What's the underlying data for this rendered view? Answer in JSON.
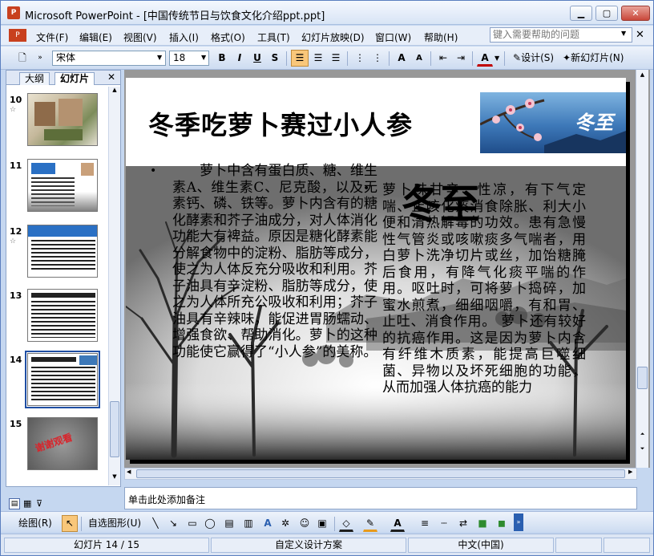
{
  "window": {
    "title": "Microsoft PowerPoint - [中国传统节日与饮食文化介绍ppt.ppt]"
  },
  "menu": [
    "文件(F)",
    "编辑(E)",
    "视图(V)",
    "插入(I)",
    "格式(O)",
    "工具(T)",
    "幻灯片放映(D)",
    "窗口(W)",
    "帮助(H)"
  ],
  "help": {
    "placeholder": "键入需要帮助的问题"
  },
  "toolbar": {
    "font": "宋体",
    "size": "18",
    "design": "设计(S)",
    "new_slide": "新幻灯片(N)"
  },
  "panel": {
    "tabs": [
      "大纲",
      "幻灯片"
    ]
  },
  "slides": [
    {
      "num": "10",
      "star": "☆"
    },
    {
      "num": "11"
    },
    {
      "num": "12",
      "star": "☆"
    },
    {
      "num": "13"
    },
    {
      "num": "14"
    },
    {
      "num": "15",
      "label": "谢谢观看"
    }
  ],
  "slide": {
    "title": "冬季吃萝卜赛过小人参",
    "bullet": "•",
    "col1": "　　萝卜中含有蛋白质、糖、维生素A、维生素C、尼克酸，以及无素钙、磷、铁等。萝卜内含有的糖化酵素和芥子油成分，对人体消化功能大有裨益。原因是糖化酵素能分解食物中的淀粉、脂肪等成分，使之为人体反充分吸收和利用。芥子油具有辛淀粉、脂肪等成分，使之为人体所充公吸收和利用；芥子油具有辛辣味，能促进胃肠蠕动、增强食欲、帮助消化。萝卜的这种功能使它赢得了“小人参”的美称。",
    "col2": "萝卜味甘辛、性凉，有下气定喘、止咳化痰消食除胀、利大小便和清热解毒的功效。患有急慢性气管炎或咳嗽痰多气喘者，用白萝卜洗净切片或丝，加饴糖腌后食用，有降气化痰平喘的作用。呕吐时，可将萝卜捣碎，加蜜水煎煮，细细咽嚼，有和胃、止吐、消食作用。 萝卜还有较好的抗癌作用。这是因为萝卜内含有纤维木质素，能提高巨噬细菌、异物以及坏死细胞的功能，从而加强人体抗癌的能力",
    "deco_char": "冬至",
    "corner_char": "冬至"
  },
  "notes": {
    "placeholder": "单击此处添加备注"
  },
  "drawbar": {
    "draw": "绘图(R)",
    "autoshape": "自选图形(U)"
  },
  "status": {
    "slide": "幻灯片 14 / 15",
    "design": "自定义设计方案",
    "lang": "中文(中国)"
  }
}
